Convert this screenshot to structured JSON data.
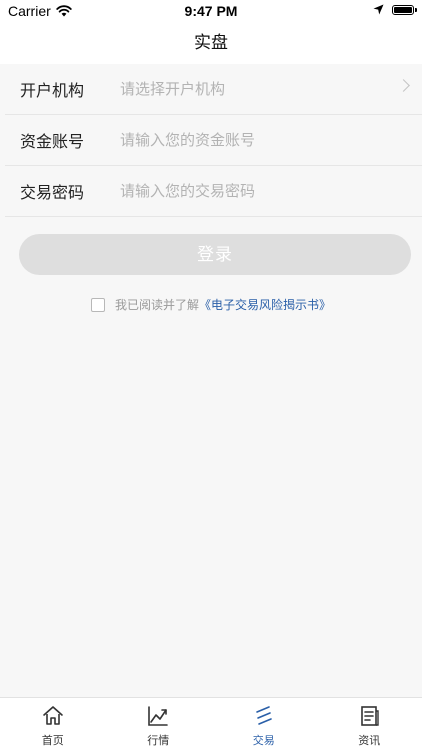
{
  "status_bar": {
    "carrier": "Carrier",
    "time": "9:47 PM"
  },
  "nav": {
    "title": "实盘"
  },
  "form": {
    "rows": [
      {
        "label": "开户机构",
        "placeholder": "请选择开户机构",
        "value": ""
      },
      {
        "label": "资金账号",
        "placeholder": "请输入您的资金账号",
        "value": ""
      },
      {
        "label": "交易密码",
        "placeholder": "请输入您的交易密码",
        "value": ""
      }
    ]
  },
  "login": {
    "label": "登录"
  },
  "agreement": {
    "checked": false,
    "prefix": "我已阅读并了解",
    "link": "《电子交易风险揭示书》"
  },
  "tabs": [
    {
      "label": "首页",
      "icon": "home-icon"
    },
    {
      "label": "行情",
      "icon": "chart-line-icon"
    },
    {
      "label": "交易",
      "icon": "trade-icon",
      "active": true
    },
    {
      "label": "资讯",
      "icon": "news-icon"
    }
  ],
  "colors": {
    "accent": "#2a5fa8",
    "button_disabled": "#dedede",
    "background": "#f7f7f7"
  }
}
